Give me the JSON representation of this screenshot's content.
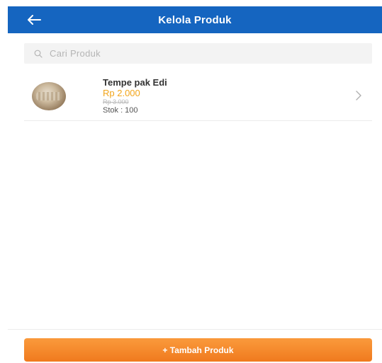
{
  "header": {
    "title": "Kelola Produk",
    "back_icon": "arrow-left-icon"
  },
  "search": {
    "placeholder": "Cari Produk",
    "icon": "search-icon"
  },
  "products": [
    {
      "name": "Tempe pak Edi",
      "price": "Rp 2.000",
      "old_price": "Rp 3.000",
      "stock": "Stok : 100",
      "chevron_icon": "chevron-right-icon"
    }
  ],
  "footer": {
    "add_label": "+ Tambah Produk"
  },
  "colors": {
    "header": "#1565c0",
    "price": "#f2a51a",
    "button": "#f08226"
  }
}
